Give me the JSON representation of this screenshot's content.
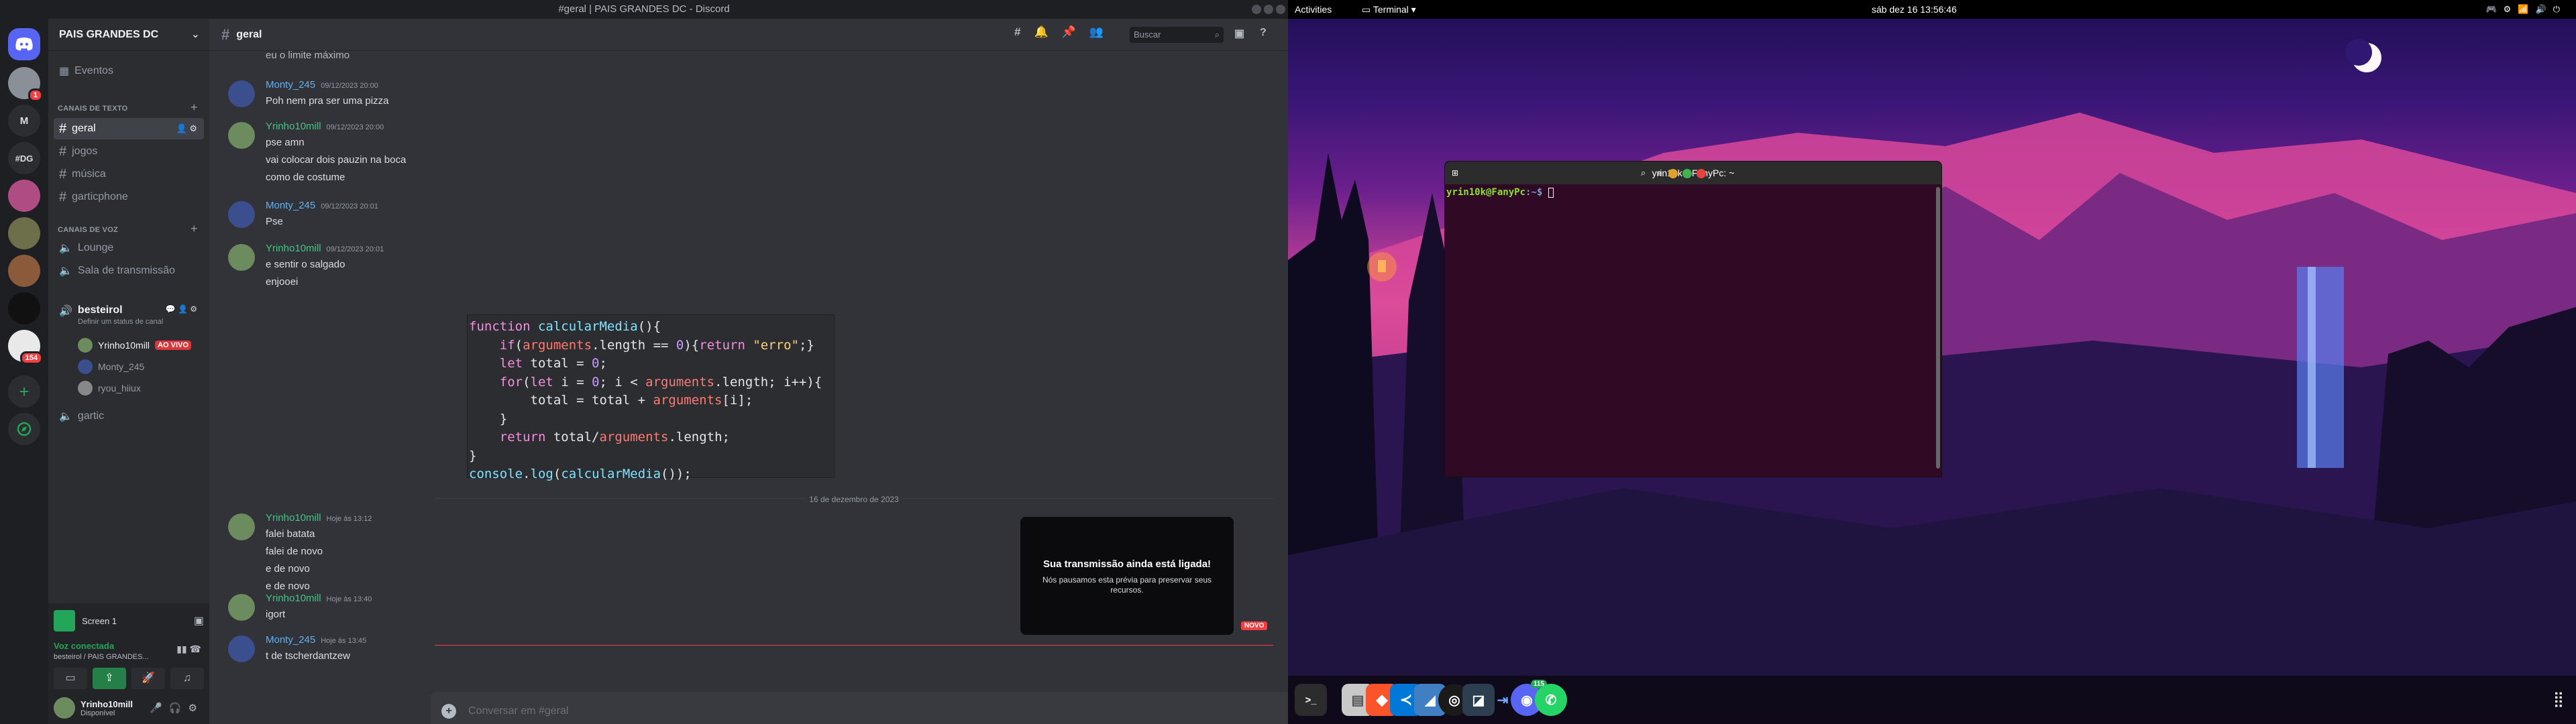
{
  "discord": {
    "window_title": "#geral | PAIS GRANDES DC - Discord",
    "servers": [
      {
        "label": "",
        "icon": "discord-home-icon"
      },
      {
        "label": "",
        "badge": "1"
      },
      {
        "label": "M"
      },
      {
        "label": "#DG"
      },
      {
        "label": ""
      },
      {
        "label": ""
      },
      {
        "label": ""
      },
      {
        "label": ""
      },
      {
        "label": "",
        "badge": "154"
      }
    ],
    "guild_name": "PAIS GRANDES DC",
    "events_label": "Eventos",
    "text_category": "CANAIS DE TEXTO",
    "text_channels": [
      "geral",
      "jogos",
      "música",
      "garticphone"
    ],
    "voice_category": "CANAIS DE VOZ",
    "voice_channels": [
      "Lounge",
      "Sala de transmissão",
      "besteirol",
      "gartic"
    ],
    "besteirol_status": "Definir um status de canal",
    "voice_users": [
      {
        "name": "Yrinho10mill",
        "live": "AO VIVO"
      },
      {
        "name": "Monty_245"
      },
      {
        "name": "ryou_hiiux"
      }
    ],
    "panel": {
      "screen_label": "Screen 1",
      "voice_connected": "Voz conectada",
      "voice_location": "besteirol / PAIS GRANDES...",
      "username": "Yrinho10mill",
      "user_status": "Disponível"
    },
    "channel_header": "geral",
    "search_placeholder": "Buscar",
    "top_cut_text": "eu o limite máximo",
    "messages": [
      {
        "author": "Monty_245",
        "color": "#5fb3f5",
        "time": "09/12/2023 20:00",
        "lines": [
          "Poh nem pra ser uma pizza"
        ]
      },
      {
        "author": "Yrinho10mill",
        "color": "#45c486",
        "time": "09/12/2023 20:00",
        "lines": [
          "pse amn",
          "vai colocar dois pauzin na boca",
          "como de costume"
        ]
      },
      {
        "author": "Monty_245",
        "color": "#5fb3f5",
        "time": "09/12/2023 20:01",
        "lines": [
          "Pse"
        ]
      },
      {
        "author": "Yrinho10mill",
        "color": "#45c486",
        "time": "09/12/2023 20:01",
        "lines": [
          "e sentir o salgado",
          "enjooei"
        ]
      }
    ],
    "code_lines": [
      "function calcularMedia(){",
      "    if(arguments.length == 0){return \"erro\";}",
      "    let total = 0;",
      "    for(let i = 0; i < arguments.length; i++){",
      "        total = total + arguments[i];",
      "    }",
      "    return total/arguments.length;",
      "}",
      "console.log(calcularMedia());"
    ],
    "date_divider": "16 de dezembro de 2023",
    "messages2": [
      {
        "author": "Yrinho10mill",
        "color": "#45c486",
        "time": "Hoje às 13:12",
        "lines": [
          "falei batata",
          "falei de novo",
          "e de novo",
          "e de novo"
        ]
      },
      {
        "author": "Yrinho10mill",
        "color": "#45c486",
        "time": "Hoje às 13:40",
        "lines": [
          "igort"
        ]
      },
      {
        "author": "Monty_245",
        "color": "#5fb3f5",
        "time": "Hoje às 13:45",
        "lines": [
          "t de tscherdantzew"
        ]
      }
    ],
    "new_tag": "NOVO",
    "toast": {
      "title": "Sua transmissão ainda está ligada!",
      "body": "Nós pausamos esta prévia para preservar seus recursos."
    },
    "composer_placeholder": "Conversar em #geral"
  },
  "ubuntu": {
    "activities": "Activities",
    "app_menu": "Terminal",
    "clock": "sáb dez 16  13:56:46",
    "terminal_title": "yrin10k@FanyPc: ~",
    "prompt_user": "yrin10k@FanyPc",
    "prompt_path": ":~$ ",
    "dock_badge": "115",
    "dock": [
      "terminal-icon",
      "files-icon",
      "brave-icon",
      "vscode-icon",
      "app-icon",
      "obs-icon",
      "app-icon",
      "app-icon",
      "discord-icon",
      "whatsapp-icon"
    ]
  }
}
